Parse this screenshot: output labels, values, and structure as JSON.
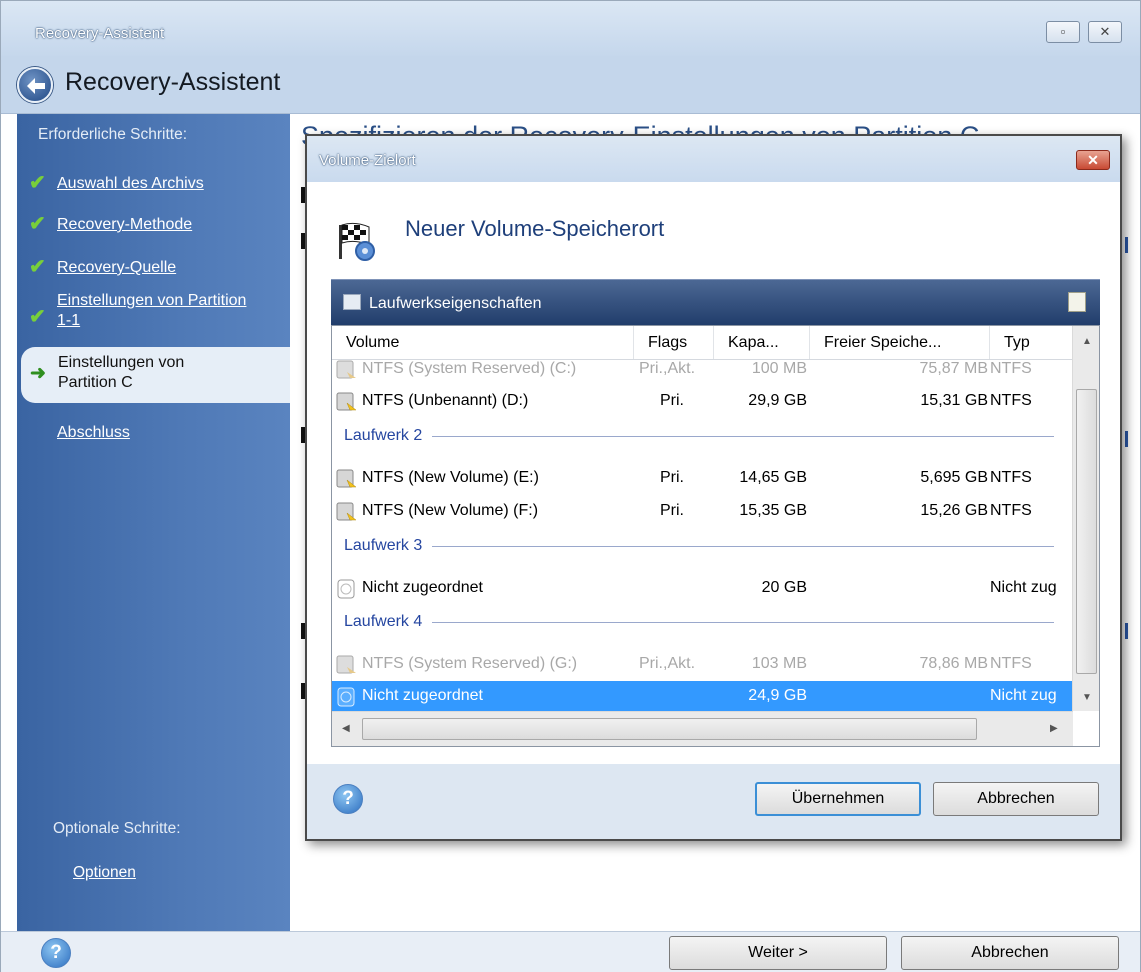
{
  "window": {
    "title": "Recovery-Assistent",
    "header_title": "Recovery-Assistent",
    "restore_glyph": "▫",
    "close_glyph": "✕"
  },
  "sidebar": {
    "required_label": "Erforderliche Schritte:",
    "steps": [
      {
        "label": "Auswahl des Archivs",
        "done": true
      },
      {
        "label": "Recovery-Methode",
        "done": true
      },
      {
        "label": "Recovery-Quelle",
        "done": true
      },
      {
        "label": "Einstellungen von Partition 1-1",
        "done": true
      },
      {
        "label": "Einstellungen von Partition C",
        "active": true
      },
      {
        "label": "Abschluss"
      }
    ],
    "optional_label": "Optionale Schritte:",
    "options_link": "Optionen"
  },
  "main": {
    "title": "Spezifizieren der Recovery-Einstellungen von Partition C"
  },
  "dialog": {
    "title": "Volume-Zielort",
    "close_glyph": "✕",
    "heading": "Neuer Volume-Speicherort",
    "properties_label": "Laufwerkseigenschaften",
    "columns": [
      "Volume",
      "Flags",
      "Kapa...",
      "Freier Speiche...",
      "Typ"
    ],
    "disks": [
      {
        "label": "",
        "rows": [
          {
            "volume": "NTFS (System Reserved) (C:)",
            "flags": "Pri.,Akt.",
            "capacity": "100 MB",
            "free": "75,87 MB",
            "type": "NTFS",
            "state": "disabled",
            "icon": "hdd-icon"
          },
          {
            "volume": "NTFS (Unbenannt) (D:)",
            "flags": "Pri.",
            "capacity": "29,9 GB",
            "free": "15,31 GB",
            "type": "NTFS",
            "state": "normal",
            "icon": "hdd-icon"
          }
        ]
      },
      {
        "label": "Laufwerk 2",
        "rows": [
          {
            "volume": "NTFS (New Volume) (E:)",
            "flags": "Pri.",
            "capacity": "14,65 GB",
            "free": "5,695 GB",
            "type": "NTFS",
            "state": "normal",
            "icon": "hdd-icon"
          },
          {
            "volume": "NTFS (New Volume) (F:)",
            "flags": "Pri.",
            "capacity": "15,35 GB",
            "free": "15,26 GB",
            "type": "NTFS",
            "state": "normal",
            "icon": "hdd-icon"
          }
        ]
      },
      {
        "label": "Laufwerk 3",
        "rows": [
          {
            "volume": "Nicht zugeordnet",
            "flags": "",
            "capacity": "20 GB",
            "free": "",
            "type": "Nicht zug",
            "state": "normal",
            "icon": "unallocated-icon"
          }
        ]
      },
      {
        "label": "Laufwerk 4",
        "rows": [
          {
            "volume": "NTFS (System Reserved) (G:)",
            "flags": "Pri.,Akt.",
            "capacity": "103 MB",
            "free": "78,86 MB",
            "type": "NTFS",
            "state": "disabled",
            "icon": "hdd-icon"
          },
          {
            "volume": "Nicht zugeordnet",
            "flags": "",
            "capacity": "24,9 GB",
            "free": "",
            "type": "Nicht zug",
            "state": "selected",
            "icon": "unallocated-icon"
          }
        ]
      }
    ],
    "help_glyph": "?",
    "ok_button": "Übernehmen",
    "cancel_button": "Abbrechen"
  },
  "bottom": {
    "help_glyph": "?",
    "next_button": "Weiter >",
    "cancel_button": "Abbrechen"
  },
  "colors": {
    "sidebar": "#4a74b1",
    "selection": "#3399ff",
    "check": "#78cf3a",
    "disk_label": "#2546a0"
  }
}
